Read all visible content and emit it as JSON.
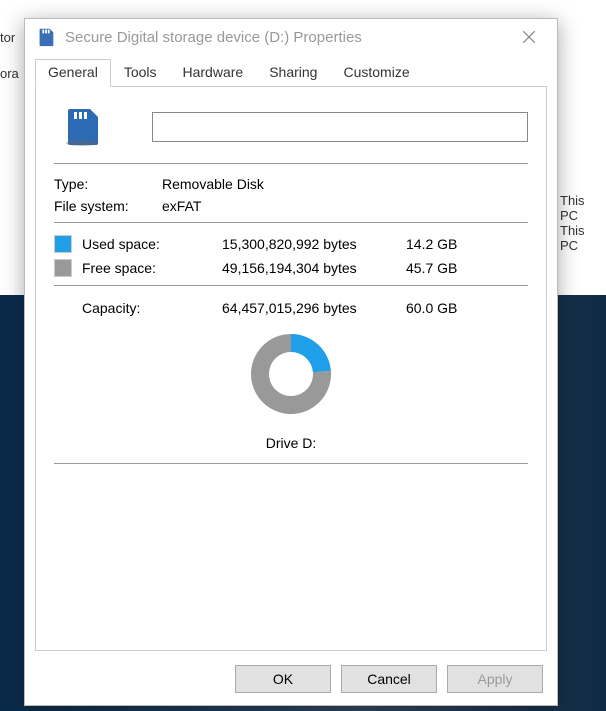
{
  "window": {
    "title": "Secure Digital storage device (D:) Properties"
  },
  "tabs": {
    "general": "General",
    "tools": "Tools",
    "hardware": "Hardware",
    "sharing": "Sharing",
    "customize": "Customize"
  },
  "general": {
    "name_value": "",
    "type_label": "Type:",
    "type_value": "Removable Disk",
    "fs_label": "File system:",
    "fs_value": "exFAT",
    "used_label": "Used space:",
    "used_bytes": "15,300,820,992 bytes",
    "used_gb": "14.2 GB",
    "free_label": "Free space:",
    "free_bytes": "49,156,194,304 bytes",
    "free_gb": "45.7 GB",
    "capacity_label": "Capacity:",
    "capacity_bytes": "64,457,015,296 bytes",
    "capacity_gb": "60.0 GB",
    "drive_label": "Drive D:"
  },
  "buttons": {
    "ok": "OK",
    "cancel": "Cancel",
    "apply": "Apply"
  },
  "chart_data": {
    "type": "pie",
    "title": "Drive D:",
    "series": [
      {
        "name": "Used space",
        "value": 15300820992,
        "gb": 14.2,
        "color": "#1e9fe8"
      },
      {
        "name": "Free space",
        "value": 49156194304,
        "gb": 45.7,
        "color": "#999999"
      }
    ],
    "total": 64457015296,
    "total_gb": 60.0
  },
  "background": {
    "pc1": "This PC",
    "pc2": "This PC",
    "left1": "tor",
    "left2": "ora"
  }
}
